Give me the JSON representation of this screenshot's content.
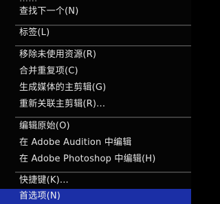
{
  "colors": {
    "menu_background": "#050505",
    "menu_text": "#e4e4e4",
    "separator": "#5a5a5a",
    "highlight_background": "#1b2fa6"
  },
  "menu": {
    "cut_top_item": "……",
    "find_next": "查找下一个(N)",
    "label": "标签(L)",
    "remove_unused": "移除未使用资源(R)",
    "consolidate_duplicates": "合并重复项(C)",
    "generate_master_clip": "生成媒体的主剪辑(G)",
    "relink_master_clip": "重新关联主剪辑(R)...",
    "edit_original": "编辑原始(O)",
    "edit_in_audition": "在 Adobe Audition 中编辑",
    "edit_in_photoshop": "在 Adobe Photoshop 中编辑(H)",
    "keyboard_shortcuts": "快捷键(K)...",
    "preferences": "首选项(N)"
  }
}
